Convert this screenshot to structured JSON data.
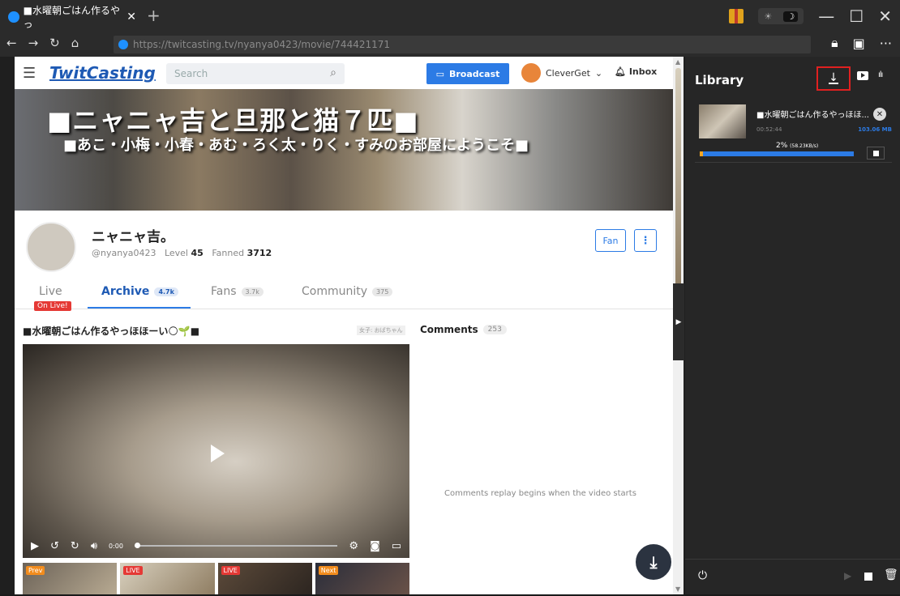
{
  "browser": {
    "tab_title": "■水曜朝ごはん作るやっ",
    "tab_close": "✕",
    "new_tab": "+",
    "url": "https://twitcasting.tv/nyanya0423/movie/744421171",
    "theme_sun": "☀",
    "theme_moon": "☽",
    "back": "←",
    "forward": "→",
    "reload": "↻",
    "home": "⌂",
    "more": "···",
    "minimize": "—",
    "maximize": "☐",
    "close": "✕"
  },
  "site": {
    "logo": "TwitCasting",
    "search_placeholder": "Search",
    "broadcast": "Broadcast",
    "user_name": "CleverGet",
    "inbox": "Inbox",
    "banner_title": "■ニャニャ吉と旦那と猫７匹■",
    "banner_subtitle": "■あこ・小梅・小春・あむ・ろく太・りく・すみのお部屋にようこそ■"
  },
  "profile": {
    "name": "ニャニャ吉。",
    "handle": "@nyanya0423",
    "level_label": "Level",
    "level": "45",
    "fanned_label": "Fanned",
    "fanned": "3712",
    "fan_button": "Fan",
    "more_button": "⋮"
  },
  "tabs": [
    {
      "label": "Live",
      "count": ""
    },
    {
      "label": "Archive",
      "count": "4.7k"
    },
    {
      "label": "Fans",
      "count": "3.7k"
    },
    {
      "label": "Community",
      "count": "375"
    }
  ],
  "on_live": "On Live!",
  "video": {
    "title": "■水曜朝ごはん作るやっほほーい🌕🌱■",
    "tag": "女子: おばちゃん",
    "time": "0:00"
  },
  "comments": {
    "label": "Comments",
    "count": "253",
    "replay_note": "Comments replay begins when the video starts"
  },
  "thumbs": [
    {
      "label": "Prev",
      "color": "orange"
    },
    {
      "label": "LIVE",
      "color": "red"
    },
    {
      "label": "LIVE",
      "color": "red"
    },
    {
      "label": "Next",
      "color": "orange"
    }
  ],
  "library": {
    "title": "Library",
    "item": {
      "title": "■水曜朝ごはん作るやっほほ...",
      "duration": "00:52:44",
      "size": "103.06 MB",
      "progress_text": "2%",
      "speed": "(58.23KB/s)",
      "progress": 0.02
    }
  }
}
